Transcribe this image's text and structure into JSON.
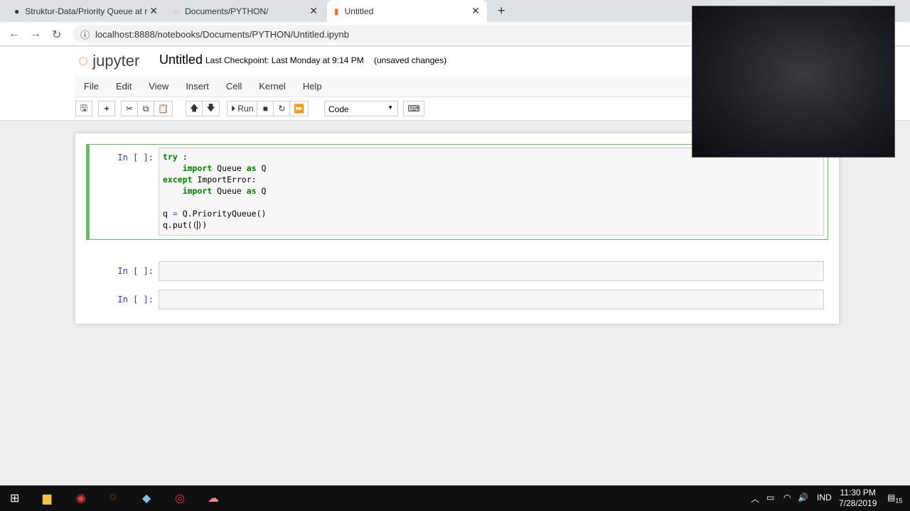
{
  "browser": {
    "tabs": [
      {
        "title": "Struktur-Data/Priority Queue at r",
        "icon": "github-icon"
      },
      {
        "title": "Documents/PYTHON/",
        "icon": "jupyter-icon"
      },
      {
        "title": "Untitled",
        "icon": "notebook-icon"
      }
    ],
    "url": "localhost:8888/notebooks/Documents/PYTHON/Untitled.ipynb"
  },
  "jupyter": {
    "logo": "jupyter",
    "title": "Untitled",
    "checkpoint": "Last Checkpoint: Last Monday at 9:14 PM",
    "status": "(unsaved changes)",
    "menu": [
      "File",
      "Edit",
      "View",
      "Insert",
      "Cell",
      "Kernel",
      "Help"
    ],
    "toolbar": {
      "run": "Run",
      "cell_type": "Code"
    }
  },
  "cells": [
    {
      "prompt": "In [ ]:",
      "code": [
        "try :",
        "    import Queue as Q",
        "except ImportError:",
        "    import Queue as Q",
        "",
        "q = Q.PriorityQueue()",
        "q.put(())"
      ]
    },
    {
      "prompt": "In [ ]:",
      "code": []
    },
    {
      "prompt": "In [ ]:",
      "code": []
    }
  ],
  "taskbar": {
    "lang": "IND",
    "time": "11:30 PM",
    "date": "7/28/2019",
    "notifications": "15"
  },
  "colors": {
    "accent": "#f37626",
    "cell_selected": "#66bb6a",
    "keyword": "#008000"
  }
}
